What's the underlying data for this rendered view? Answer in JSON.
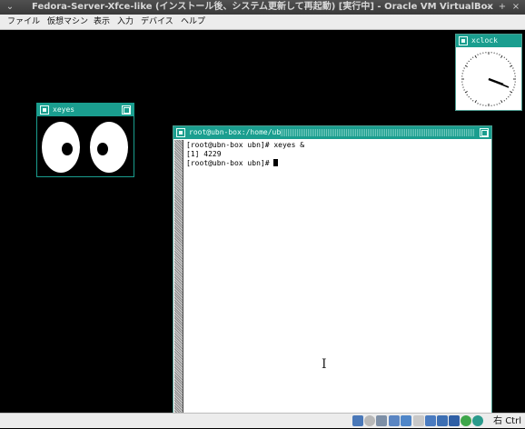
{
  "host": {
    "title": "Fedora-Server-Xfce-like (インストール後、システム更新して再起動) [実行中] - Oracle VM VirtualBox",
    "menu_icon": "chevron-down-icon",
    "controls": [
      "minimize-icon",
      "maximize-icon",
      "close-icon"
    ]
  },
  "menu": {
    "items": [
      "ファイル",
      "仮想マシン",
      "表示",
      "入力",
      "デバイス",
      "ヘルプ"
    ]
  },
  "xeyes": {
    "title": "xeyes"
  },
  "xclock": {
    "title": "xclock"
  },
  "terminal": {
    "title": "root@ubn-box:/home/ubn",
    "lines": [
      "[root@ubn-box ubn]# xeyes &",
      "[1] 4229",
      "[root@ubn-box ubn]# "
    ]
  },
  "statusbar": {
    "host_key": "右 Ctrl",
    "icons": [
      "hdd-icon",
      "optical-drive-icon",
      "audio-icon",
      "network-icon",
      "usb-icon",
      "shared-folder-icon",
      "display-icon",
      "video-capture-icon",
      "virtualization-icon",
      "cpu-icon",
      "mouse-integration-icon",
      "keyboard-icon"
    ]
  },
  "colors": {
    "twm_title": "#1a9e8f",
    "desktop": "#000000",
    "eye_white": "#ffffff"
  }
}
